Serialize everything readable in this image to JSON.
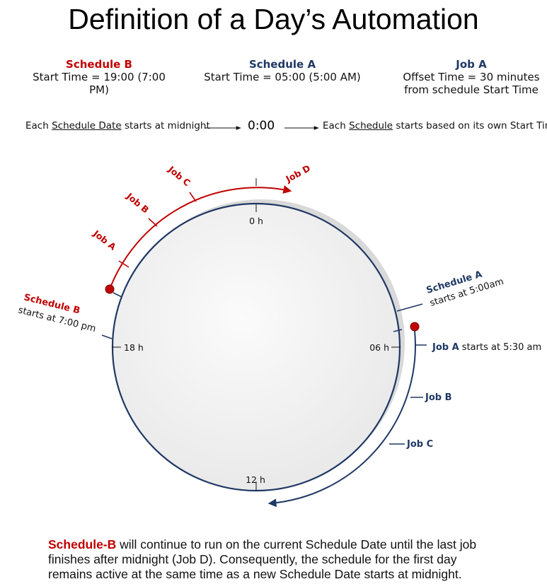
{
  "title": "Definition of a Day’s Automation",
  "schedule_b": {
    "heading": "Schedule B",
    "line": "Start Time = 19:00 (7:00 PM)"
  },
  "schedule_a": {
    "heading": "Schedule A",
    "line": "Start Time = 05:00 (5:00 AM)"
  },
  "job_a": {
    "heading": "Job A",
    "line1": "Offset Time = 30 minutes",
    "line2": "from schedule Start Time"
  },
  "flow": {
    "left_prefix": "Each ",
    "left_u": "Schedule Date",
    "left_suffix": " starts at midnight",
    "center": "0:00",
    "right_prefix": "Each ",
    "right_u": "Schedule",
    "right_suffix": " starts based on its own Start Time"
  },
  "clock": {
    "label_0": "0 h",
    "label_6": "06 h",
    "label_12": "12 h",
    "label_18": "18 h"
  },
  "red_jobs": {
    "a": "Job A",
    "b": "Job B",
    "c": "Job C",
    "d": "Job D"
  },
  "red_sched": {
    "name": "Schedule B",
    "start": "starts at 7:00 pm"
  },
  "blue_sched": {
    "name": "Schedule A",
    "start": "starts at 5:00am"
  },
  "blue_jobs": {
    "a_bold": "Job A",
    "a_rest": " starts at 5:30 am",
    "b": "Job B",
    "c": "Job C"
  },
  "note": {
    "bold": "Schedule-B",
    "line1": " will continue to run on the current Schedule Date until the last job",
    "line2": "finishes after midnight (Job D). Consequently, the schedule for the first day",
    "line3": "remains active at the same time as a new Schedule Date starts at midnight."
  },
  "colors": {
    "red": "#C00000",
    "navy": "#1F3864",
    "face": "#f2f2f2",
    "shadow": "#d9d9d9"
  }
}
